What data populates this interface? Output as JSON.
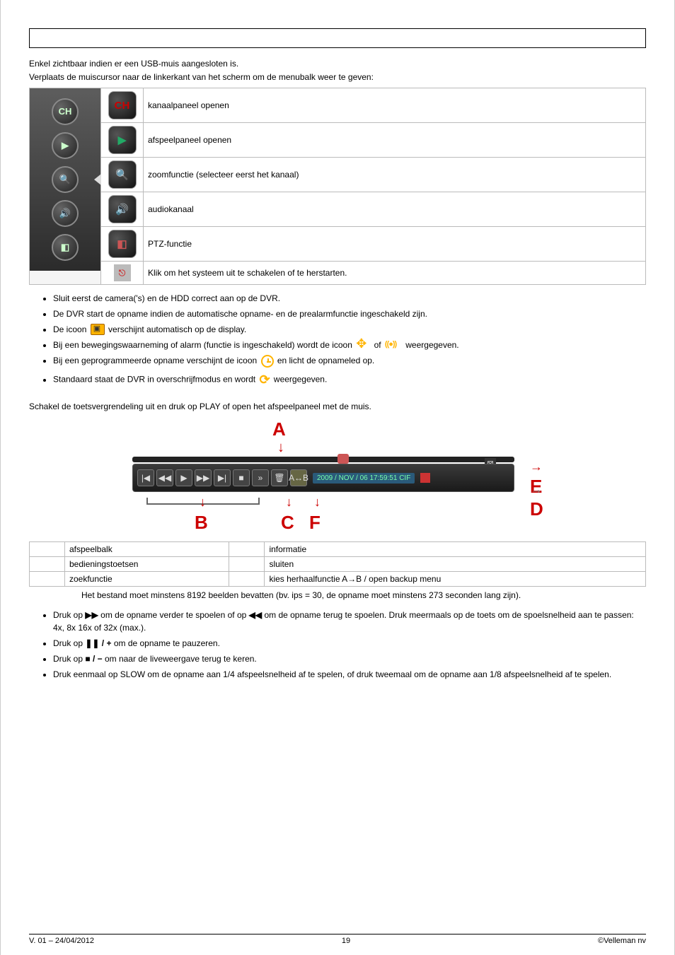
{
  "intro": {
    "line1": "Enkel zichtbaar indien er een USB-muis aangesloten is.",
    "line2": "Verplaats de muiscursor naar de linkerkant van het scherm om de menubalk weer te geven:"
  },
  "menubar": {
    "rows": [
      {
        "icon": "ch-icon",
        "label": "CH",
        "desc": "kanaalpaneel openen"
      },
      {
        "icon": "play-icon",
        "label": "",
        "desc": "afspeelpaneel openen"
      },
      {
        "icon": "zoom-icon",
        "label": "",
        "desc": "zoomfunctie (selecteer eerst het kanaal)"
      },
      {
        "icon": "audio-icon",
        "label": "",
        "desc": "audiokanaal"
      },
      {
        "icon": "ptz-icon",
        "label": "",
        "desc": "PTZ-functie"
      },
      {
        "icon": "shutdown-icon",
        "label": "",
        "desc": "Klik om het systeem uit te schakelen of te herstarten."
      }
    ]
  },
  "bullets1": [
    "Sluit eerst de camera('s) en de HDD correct aan op de DVR.",
    "De DVR start de opname indien de automatische opname- en de prealarmfunctie ingeschakeld zijn.",
    {
      "pre": "De icoon ",
      "iconName": "record-icon",
      "post": " verschijnt automatisch op de display."
    },
    {
      "pre": "Bij een bewegingswaarneming of alarm (functie is ingeschakeld) wordt de icoon ",
      "iconName": "motion-icon",
      "mid": " of ",
      "iconName2": "motion2-icon",
      "post": " weergegeven."
    },
    {
      "pre": "Bij een geprogrammeerde opname verschijnt de icoon ",
      "iconName": "clock-icon",
      "post": " en licht de opnameled op."
    },
    {
      "pre": "Standaard staat de DVR in overschrijfmodus en wordt ",
      "iconName": "overwrite-icon",
      "post": " weergegeven."
    }
  ],
  "playback_intro": "Schakel de toetsvergrendeling uit en druk op PLAY of open het afspeelpaneel met de muis.",
  "figure": {
    "labels": {
      "A": "A",
      "B": "B",
      "C": "C",
      "D": "D",
      "E": "E",
      "F": "F"
    },
    "timestamp": "2009 / NOV / 06  17:59:51   CIF",
    "buttons": [
      "|◀",
      "◀◀",
      "▶",
      "▶▶",
      "▶|",
      "■",
      "»",
      "🗑",
      "A↔B"
    ]
  },
  "label_table": [
    {
      "left": "afspeelbalk",
      "right": "informatie"
    },
    {
      "left": "bedieningstoetsen",
      "right": "sluiten"
    },
    {
      "left": "zoekfunctie",
      "right": "kies herhaalfunctie A→B / open backup menu"
    }
  ],
  "note": "Het bestand moet minstens 8192 beelden bevatten (bv. ips = 30, de opname moet minstens 273 seconden lang zijn).",
  "bullets2": [
    {
      "pre": "Druk op ",
      "sym": "▶▶",
      "mid": " om de opname verder te spoelen of op ",
      "sym2": "◀◀",
      "post": " om de opname terug te spoelen. Druk meermaals op de toets om de spoelsnelheid aan te passen: 4x, 8x 16x of 32x (max.)."
    },
    {
      "pre": "Druk op ",
      "sym": "❚❚ / +",
      "post": " om de opname te pauzeren."
    },
    {
      "pre": "Druk op ",
      "sym": "■ / −",
      "post": " om naar de liveweergave terug te keren."
    },
    "Druk eenmaal op SLOW om de opname aan 1/4 afspeelsnelheid af te spelen, of druk tweemaal om de opname aan 1/8 afspeelsnelheid af te spelen."
  ],
  "footer": {
    "left": "V. 01 – 24/04/2012",
    "center": "19",
    "right": "©Velleman nv"
  }
}
